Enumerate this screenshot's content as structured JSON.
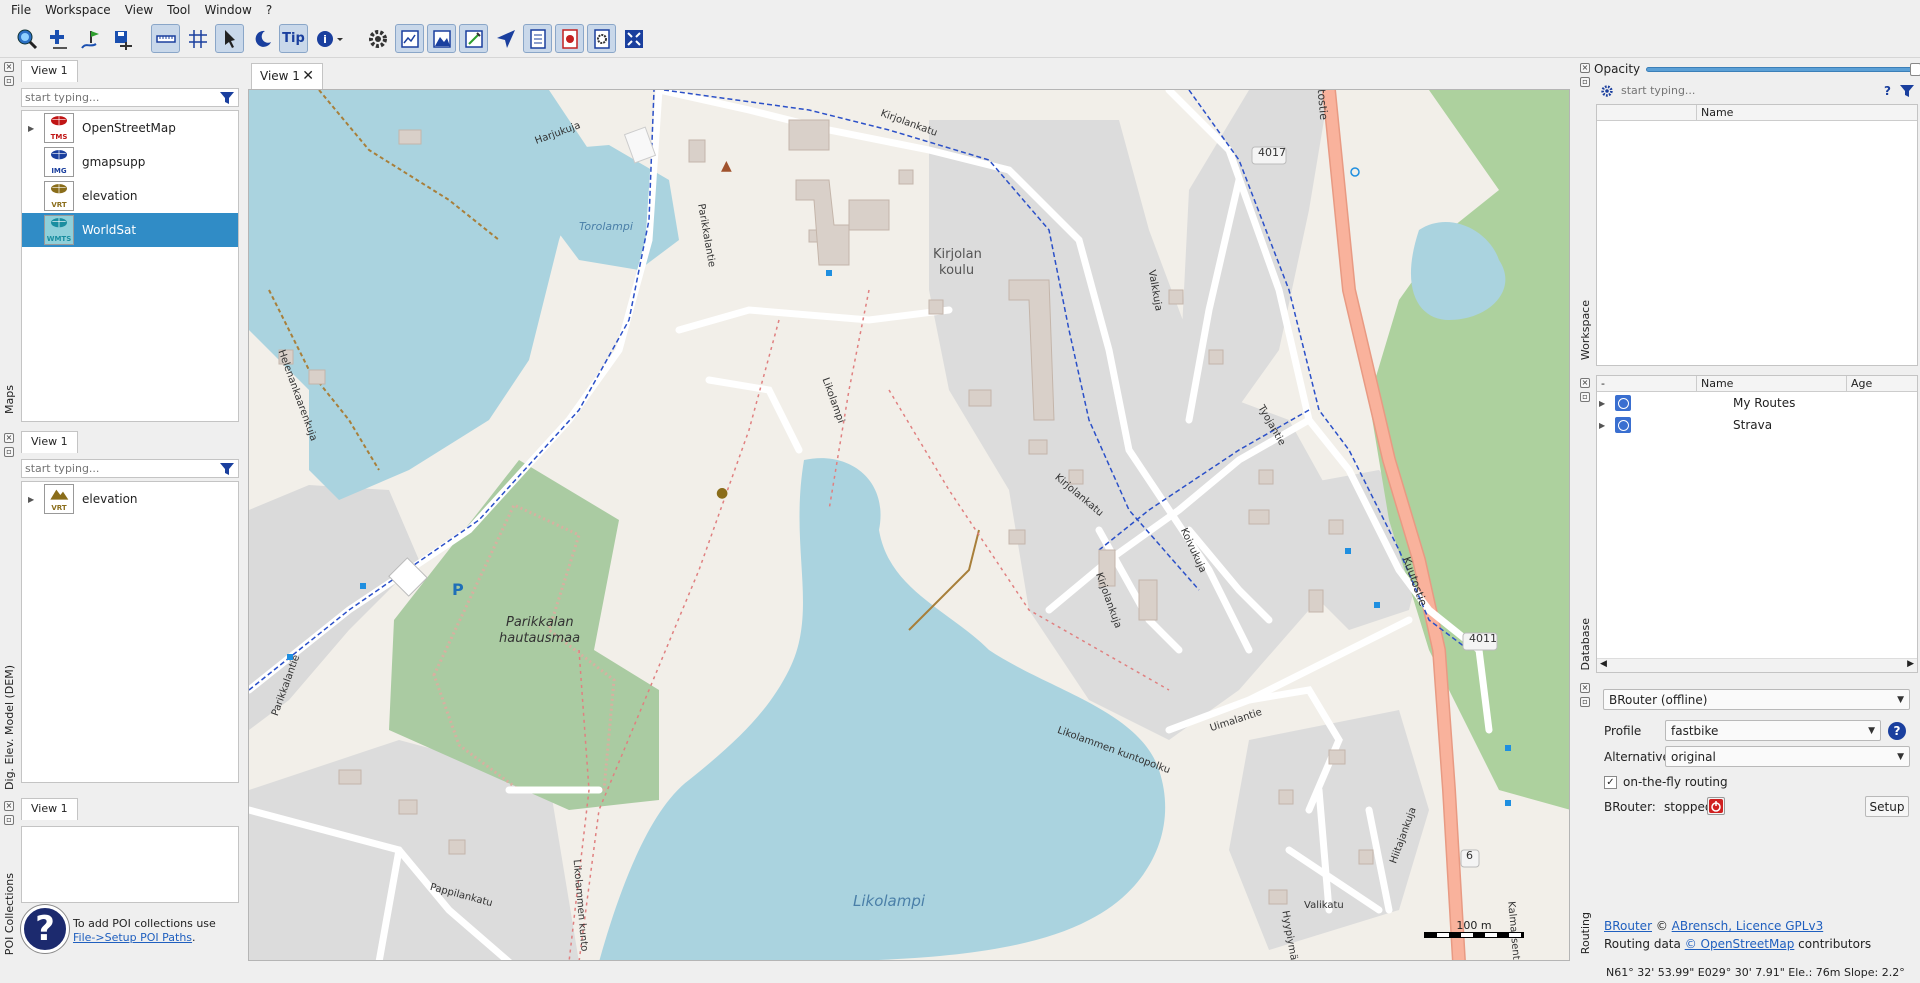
{
  "menu": [
    "File",
    "Workspace",
    "View",
    "Tool",
    "Window",
    "?"
  ],
  "toolbar": {
    "tip_label": "Tip",
    "icons": [
      "search-location-icon",
      "add-waypoint-icon",
      "route-flag-icon",
      "save-project-icon",
      "ruler-icon",
      "grid-icon",
      "cursor-arrow-icon",
      "night-mode-icon",
      "tip-icon",
      "info-icon",
      "settings-gear-icon",
      "map-view-icon",
      "elevation-view-icon",
      "track-edit-icon",
      "navigate-icon",
      "workspace-toggle-icon",
      "database-toggle-icon",
      "poi-toggle-icon",
      "fullscreen-icon"
    ]
  },
  "maps_panel": {
    "side_label": "Maps",
    "tab": "View 1",
    "filter_placeholder": "start typing...",
    "items": [
      {
        "name": "OpenStreetMap",
        "type": "TMS",
        "color": "#c01515",
        "selected": false
      },
      {
        "name": "gmapsupp",
        "type": "IMG",
        "color": "#1a3f9e",
        "selected": false
      },
      {
        "name": "elevation",
        "type": "VRT",
        "color": "#8a6d1a",
        "selected": false
      },
      {
        "name": "WorldSat",
        "type": "WMTS",
        "color": "#1a8ea0",
        "selected": true
      }
    ]
  },
  "dem_panel": {
    "side_label": "Dig. Elev. Model (DEM)",
    "tab": "View 1",
    "filter_placeholder": "start typing...",
    "items": [
      {
        "name": "elevation",
        "type": "VRT",
        "color": "#8a6d1a"
      }
    ]
  },
  "poi_panel": {
    "side_label": "POI Collections",
    "tab": "View 1",
    "help_text": "To add POI collections use",
    "help_link": "File->Setup POI Paths",
    "help_end": "."
  },
  "map_view": {
    "tab": "View 1",
    "scale_label": "100 m",
    "labels": {
      "torolampi": "Torolampi",
      "likolampi": "Likolampi",
      "kirjolan_koulu_1": "Kirjolan",
      "kirjolan_koulu_2": "koulu",
      "parikkalan_1": "Parikkalan",
      "parikkalan_2": "hautausmaa",
      "harjukuja": "Harjukuja",
      "kirjolankatu": "Kirjolankatu",
      "kirjolankatu2": "Kirjolankatu",
      "parikkalantie": "Parikkalantie",
      "parikkalantie2": "Parikkalantie",
      "helenankaarenkuja": "Helenankaarenkuja",
      "likolampi_road": "Likolampi",
      "valkkuja": "Valkkuja",
      "tyojantie": "Tyojantie",
      "kirjolankuja": "Kirjolankuja",
      "koivukuja": "Koivukuja",
      "kuutostie": "Kuutostie",
      "kuutostie_top": "tostie",
      "uimalantie": "Uimalantie",
      "likolammen_kuntopolku": "Likolammen kuntopolku",
      "likolammen_kuntopolku2": "Likolammen kunto",
      "pappilankatu": "Pappilankatu",
      "valikatu": "Valikatu",
      "hiitajankuja": "Hiitajankuja",
      "hyypiyma": "Hyypiymä",
      "kalmaksentie": "Kalmaksent",
      "road_4017": "4017",
      "road_4011": "4011",
      "road_6": "6",
      "parking": "P"
    }
  },
  "workspace_panel": {
    "side_label": "Workspace",
    "opacity_label": "Opacity",
    "opacity_value": 1.0,
    "filter_placeholder": "start typing...",
    "columns": [
      "",
      "Name"
    ]
  },
  "database_panel": {
    "side_label": "Database",
    "columns": [
      "-",
      "Name",
      "Age"
    ],
    "items": [
      {
        "name": "My Routes"
      },
      {
        "name": "Strava"
      }
    ]
  },
  "routing_panel": {
    "side_label": "Routing",
    "router": "BRouter (offline)",
    "profile_label": "Profile",
    "profile_value": "fastbike",
    "alternative_label": "Alternative",
    "alternative_value": "original",
    "on_the_fly_label": "on-the-fly routing",
    "on_the_fly_checked": true,
    "status_label": "BRouter:",
    "status_value": "stopped",
    "setup_label": "Setup",
    "credit_link1": "BRouter",
    "credit_mid": "©",
    "credit_link2": "ABrensch, Licence GPLv3",
    "credit2_pre": "Routing data",
    "credit2_link": "© OpenStreetMap",
    "credit2_post": "contributors"
  },
  "status_bar": {
    "position": "N61° 32' 53.99\" E029° 30' 7.91\"   Ele.: 76m   Slope: 2.2°"
  }
}
